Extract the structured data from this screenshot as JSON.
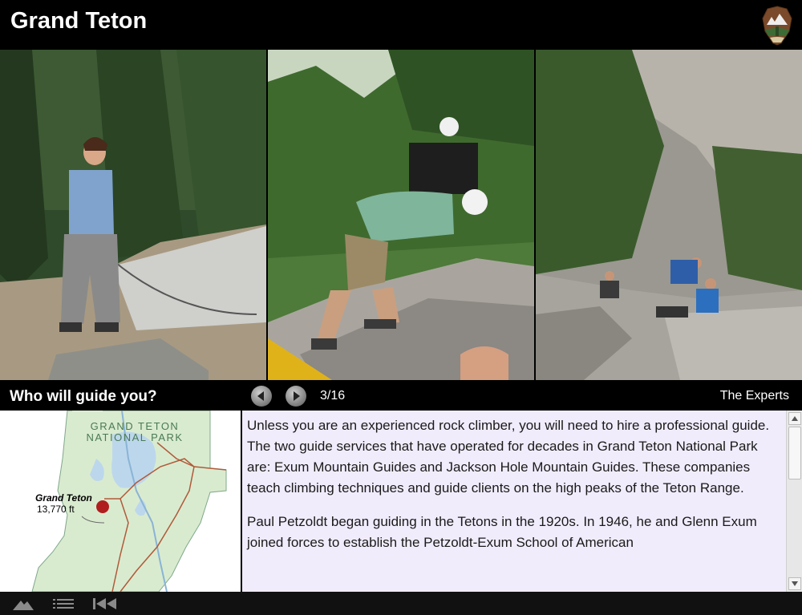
{
  "header": {
    "title": "Grand Teton",
    "logo_icon": "nps-arrowhead-icon"
  },
  "caption_bar": {
    "slide_title": "Who will guide you?",
    "prev_icon": "prev-arrow-icon",
    "next_icon": "next-arrow-icon",
    "counter": "3/16",
    "section_label": "The Experts"
  },
  "map": {
    "park_name_line1": "GRAND TETON",
    "park_name_line2": "NATIONAL PARK",
    "peak_name": "Grand Teton",
    "peak_elevation": "13,770 ft",
    "marker_color": "#b01e1e",
    "park_fill_color": "#d9ebcf",
    "water_color": "#bcd7ec"
  },
  "text_panel": {
    "paragraph_1": "Unless you are an experienced rock climber, you will need to hire a professional guide. The two guide services that have operated for decades in Grand Teton National Park are: Exum Mountain Guides and Jackson Hole Mountain Guides. These companies teach climbing techniques and guide clients on the high peaks of the Teton Range.",
    "paragraph_2": "Paul Petzoldt began guiding in the Tetons in the 1920s. In 1946, he and Glenn Exum joined forces to establish the Petzoldt-Exum School of American"
  },
  "footer": {
    "buttons": [
      "mountain-icon",
      "list-icon",
      "rewind-to-start-icon"
    ]
  }
}
